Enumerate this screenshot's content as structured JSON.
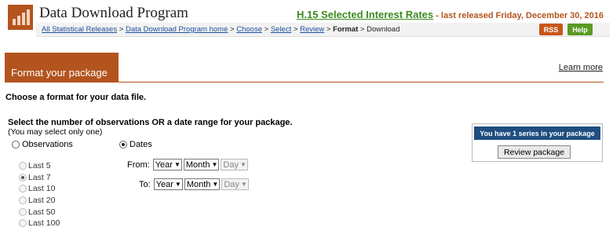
{
  "header": {
    "app_title": "Data Download Program",
    "release_link": "H.15 Selected Interest Rates",
    "release_suffix": "- last released Friday, December 30, 2016",
    "logo_icon": "bar-chart-icon"
  },
  "breadcrumb": {
    "items": [
      {
        "label": "All Statistical Releases",
        "link": true
      },
      {
        "label": "Data Download Program home",
        "link": true
      },
      {
        "label": "Choose",
        "link": true
      },
      {
        "label": "Select",
        "link": true
      },
      {
        "label": "Review",
        "link": true
      },
      {
        "label": "Format",
        "link": false,
        "current": true
      },
      {
        "label": "Download",
        "link": false
      }
    ],
    "separator": ">"
  },
  "buttons": {
    "rss": "RSS",
    "help": "Help"
  },
  "section": {
    "title": "Format your package",
    "learn_more": "Learn more"
  },
  "main": {
    "choose_text": "Choose a format for your data file.",
    "select_title": "Select the number of observations OR a date range for your package.",
    "select_note": "(You may select only one)",
    "observations_label": "Observations",
    "dates_label": "Dates",
    "mode_selected": "Dates",
    "last_options": [
      "Last 5",
      "Last 7",
      "Last 10",
      "Last 20",
      "Last 50",
      "Last 100"
    ],
    "last_selected": "Last 7",
    "from_label": "From:",
    "to_label": "To:",
    "from": {
      "year": "Year",
      "month": "Month",
      "day": "Day"
    },
    "to": {
      "year": "Year",
      "month": "Month",
      "day": "Day"
    }
  },
  "package": {
    "summary": "You have 1 series in your package",
    "review_button": "Review package"
  },
  "colors": {
    "brand": "#b3541e",
    "release_link": "#3b8a1f",
    "rss": "#c9561c",
    "help": "#5a9a23",
    "package_header": "#1f4e80"
  }
}
